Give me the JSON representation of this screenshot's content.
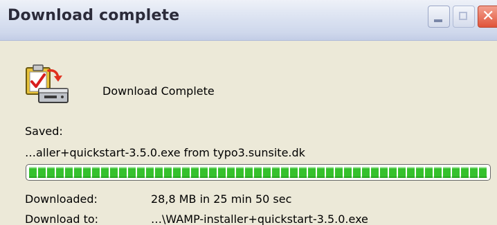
{
  "window": {
    "title": "Download complete",
    "controls": {
      "minimize_icon": "minimize-icon",
      "maximize_icon": "maximize-icon",
      "close_icon": "close-icon"
    }
  },
  "dialog": {
    "icon": "download-complete-icon",
    "heading": "Download Complete",
    "saved_label": "Saved:",
    "saved_file": "…aller+quickstart-3.5.0.exe from typo3.sunsite.dk",
    "progress_percent": 100,
    "downloaded_label": "Downloaded:",
    "downloaded_value": "28,8 MB in 25 min 50 sec",
    "download_to_label": "Download to:",
    "download_to_value": "…\\WAMP-installer+quickstart-3.5.0.exe"
  },
  "colors": {
    "progress_fill": "#35c12d",
    "close_button": "#e0543a"
  }
}
